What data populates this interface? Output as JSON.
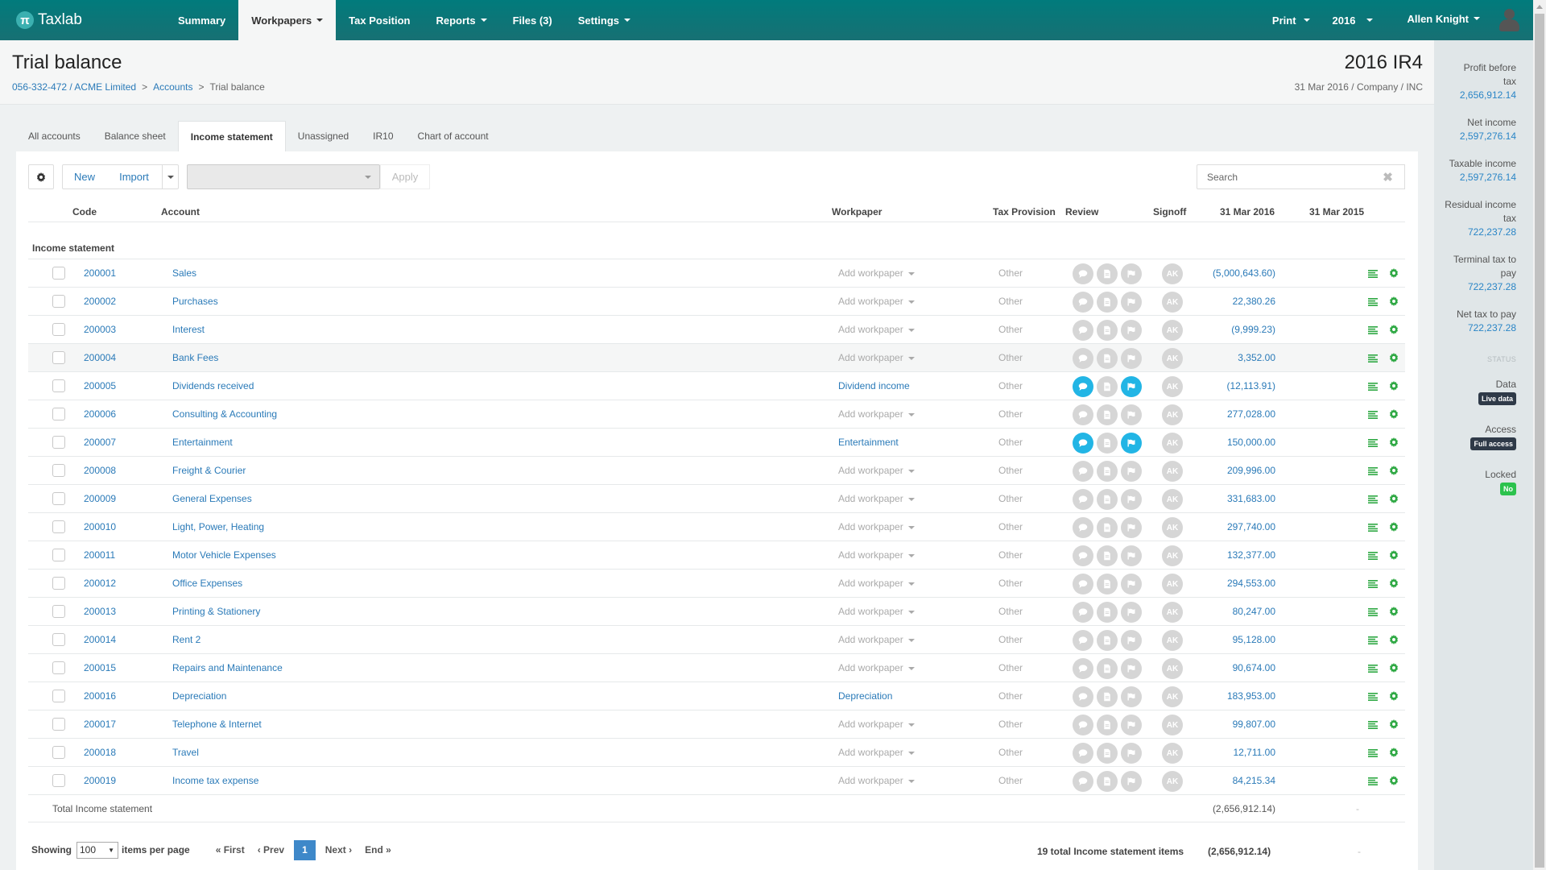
{
  "app": {
    "name": "Taxlab",
    "logo_glyph": "π",
    "nav": [
      {
        "label": "Summary",
        "dropdown": false,
        "active": false
      },
      {
        "label": "Workpapers",
        "dropdown": true,
        "active": true
      },
      {
        "label": "Tax Position",
        "dropdown": false,
        "active": false
      },
      {
        "label": "Reports",
        "dropdown": true,
        "active": false
      },
      {
        "label": "Files (3)",
        "dropdown": false,
        "active": false
      },
      {
        "label": "Settings",
        "dropdown": true,
        "active": false
      }
    ],
    "nav_right": {
      "print": "Print",
      "year": "2016",
      "user": "Allen Knight"
    }
  },
  "header": {
    "title": "Trial balance",
    "breadcrumb": [
      "056-332-472 / ACME Limited",
      "Accounts",
      "Trial balance"
    ],
    "breadcrumb_sep": ">",
    "return_title": "2016 IR4",
    "return_sub": "31 Mar 2016 / Company / INC"
  },
  "summary": {
    "items": [
      {
        "label": "Profit before tax",
        "value": "2,656,912.14"
      },
      {
        "label": "Net income",
        "value": "2,597,276.14"
      },
      {
        "label": "Taxable income",
        "value": "2,597,276.14"
      },
      {
        "label": "Residual income tax",
        "value": "722,237.28"
      },
      {
        "label": "Terminal tax to pay",
        "value": "722,237.28"
      },
      {
        "label": "Net tax to pay",
        "value": "722,237.28"
      }
    ],
    "status_heading": "STATUS",
    "status": [
      {
        "label": "Data",
        "badge": "Live data",
        "color": "#2f3a48"
      },
      {
        "label": "Access",
        "badge": "Full access",
        "color": "#2f3a48"
      },
      {
        "label": "Locked",
        "badge": "No",
        "color": "#2cc24d"
      }
    ]
  },
  "tabs": [
    {
      "label": "All accounts",
      "active": false
    },
    {
      "label": "Balance sheet",
      "active": false
    },
    {
      "label": "Income statement",
      "active": true
    },
    {
      "label": "Unassigned",
      "active": false
    },
    {
      "label": "IR10",
      "active": false
    },
    {
      "label": "Chart of account",
      "active": false
    }
  ],
  "toolbar": {
    "new_label": "New",
    "import_label": "Import",
    "bulk_select_value": "",
    "apply_label": "Apply",
    "search_placeholder": "Search",
    "clear_glyph": "✖"
  },
  "table": {
    "columns": {
      "code": "Code",
      "account": "Account",
      "workpaper": "Workpaper",
      "tax_provision": "Tax Provision",
      "review": "Review",
      "signoff": "Signoff",
      "current": "31 Mar 2016",
      "prior": "31 Mar 2015"
    },
    "group_label": "Income statement",
    "add_workpaper_label": "Add workpaper",
    "signoff_initials": "AK",
    "rows": [
      {
        "code": "200001",
        "account": "Sales",
        "workpaper": null,
        "provision": "Other",
        "review": [
          false,
          false,
          false
        ],
        "current": "(5,000,643.60)",
        "prior": ""
      },
      {
        "code": "200002",
        "account": "Purchases",
        "workpaper": null,
        "provision": "Other",
        "review": [
          false,
          false,
          false
        ],
        "current": "22,380.26",
        "prior": ""
      },
      {
        "code": "200003",
        "account": "Interest",
        "workpaper": null,
        "provision": "Other",
        "review": [
          false,
          false,
          false
        ],
        "current": "(9,999.23)",
        "prior": ""
      },
      {
        "code": "200004",
        "account": "Bank Fees",
        "workpaper": null,
        "provision": "Other",
        "review": [
          false,
          false,
          false
        ],
        "current": "3,352.00",
        "prior": "",
        "hover": true
      },
      {
        "code": "200005",
        "account": "Dividends received",
        "workpaper": "Dividend income",
        "provision": "Other",
        "review": [
          true,
          false,
          true
        ],
        "current": "(12,113.91)",
        "prior": ""
      },
      {
        "code": "200006",
        "account": "Consulting & Accounting",
        "workpaper": null,
        "provision": "Other",
        "review": [
          false,
          false,
          false
        ],
        "current": "277,028.00",
        "prior": ""
      },
      {
        "code": "200007",
        "account": "Entertainment",
        "workpaper": "Entertainment",
        "provision": "Other",
        "review": [
          true,
          false,
          true
        ],
        "current": "150,000.00",
        "prior": ""
      },
      {
        "code": "200008",
        "account": "Freight & Courier",
        "workpaper": null,
        "provision": "Other",
        "review": [
          false,
          false,
          false
        ],
        "current": "209,996.00",
        "prior": ""
      },
      {
        "code": "200009",
        "account": "General Expenses",
        "workpaper": null,
        "provision": "Other",
        "review": [
          false,
          false,
          false
        ],
        "current": "331,683.00",
        "prior": ""
      },
      {
        "code": "200010",
        "account": "Light, Power, Heating",
        "workpaper": null,
        "provision": "Other",
        "review": [
          false,
          false,
          false
        ],
        "current": "297,740.00",
        "prior": ""
      },
      {
        "code": "200011",
        "account": "Motor Vehicle Expenses",
        "workpaper": null,
        "provision": "Other",
        "review": [
          false,
          false,
          false
        ],
        "current": "132,377.00",
        "prior": ""
      },
      {
        "code": "200012",
        "account": "Office Expenses",
        "workpaper": null,
        "provision": "Other",
        "review": [
          false,
          false,
          false
        ],
        "current": "294,553.00",
        "prior": ""
      },
      {
        "code": "200013",
        "account": "Printing & Stationery",
        "workpaper": null,
        "provision": "Other",
        "review": [
          false,
          false,
          false
        ],
        "current": "80,247.00",
        "prior": ""
      },
      {
        "code": "200014",
        "account": "Rent 2",
        "workpaper": null,
        "provision": "Other",
        "review": [
          false,
          false,
          false
        ],
        "current": "95,128.00",
        "prior": ""
      },
      {
        "code": "200015",
        "account": "Repairs and Maintenance",
        "workpaper": null,
        "provision": "Other",
        "review": [
          false,
          false,
          false
        ],
        "current": "90,674.00",
        "prior": ""
      },
      {
        "code": "200016",
        "account": "Depreciation",
        "workpaper": "Depreciation",
        "provision": "Other",
        "review": [
          false,
          false,
          false
        ],
        "current": "183,953.00",
        "prior": ""
      },
      {
        "code": "200017",
        "account": "Telephone & Internet",
        "workpaper": null,
        "provision": "Other",
        "review": [
          false,
          false,
          false
        ],
        "current": "99,807.00",
        "prior": ""
      },
      {
        "code": "200018",
        "account": "Travel",
        "workpaper": null,
        "provision": "Other",
        "review": [
          false,
          false,
          false
        ],
        "current": "12,711.00",
        "prior": ""
      },
      {
        "code": "200019",
        "account": "Income tax expense",
        "workpaper": null,
        "provision": "Other",
        "review": [
          false,
          false,
          false
        ],
        "current": "84,215.34",
        "prior": ""
      }
    ],
    "total": {
      "label": "Total Income statement",
      "current": "(2,656,912.14)",
      "prior": "-"
    }
  },
  "footer": {
    "showing_label": "Showing",
    "per_page_value": "100",
    "per_page_suffix": "items per page",
    "pager": {
      "first": "« First",
      "prev": "‹ Prev",
      "current": "1",
      "next": "Next ›",
      "end": "End »"
    },
    "total_items_label": "19 total Income statement items",
    "total_current": "(2,656,912.14)",
    "total_prior": "-"
  },
  "colors": {
    "brand": "#017b7c",
    "link": "#2a7ab8",
    "review_active": "#22b5e5",
    "action_green": "#2ea843",
    "page_active": "#3e88c9"
  }
}
